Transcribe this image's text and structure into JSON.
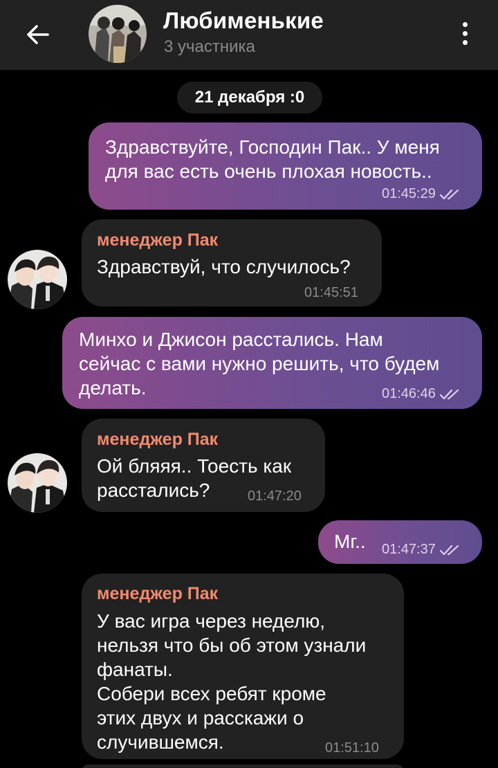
{
  "header": {
    "title": "Любименькие",
    "subtitle": "3 участника",
    "back_icon": "arrow-left-icon",
    "menu_icon": "more-vertical-icon"
  },
  "date_chip": "21 декабря :0",
  "colors": {
    "header_bg": "#222222",
    "incoming_bubble": "#222222",
    "outgoing_gradient_start": "#8d4b8c",
    "outgoing_gradient_end": "#5f4d8f",
    "sender_name": "#f18a6f"
  },
  "messages": [
    {
      "direction": "outgoing",
      "text": "Здравствуйте, Господин Пак.. У меня\nдля вас есть очень плохая новость..",
      "time": "01:45:29",
      "status": "read"
    },
    {
      "direction": "incoming",
      "sender": "менеджер Пак",
      "text": "Здравствуй, что случилось?",
      "time": "01:45:51"
    },
    {
      "direction": "outgoing",
      "text": "Минхо и Джисон расстались. Нам\nсейчас с вами нужно решить, что будем\nделать.",
      "time": "01:46:46",
      "status": "read"
    },
    {
      "direction": "incoming",
      "sender": "менеджер Пак",
      "text": "Ой бляяя.. Тоесть как\nрасстались?",
      "time": "01:47:20"
    },
    {
      "direction": "outgoing",
      "text": "Мг..",
      "time": "01:47:37",
      "status": "read"
    },
    {
      "direction": "incoming",
      "sender": "менеджер Пак",
      "text": "У вас игра через неделю,\nнельзя что бы об этом узнали\nфанаты.\nСобери всех ребят кроме\nэтих двух и расскажи о\nслучившемся.",
      "time": "01:51:10"
    }
  ]
}
